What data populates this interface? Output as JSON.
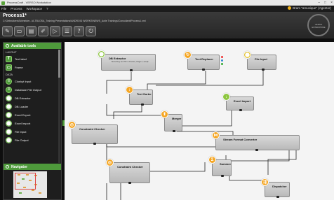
{
  "window": {
    "title": "ProcessCraft - VERSO Workstation"
  },
  "menu": {
    "items": [
      "File",
      "Process",
      "Workspace",
      "?"
    ],
    "user": "Bram \"amusique\" (Agentor)"
  },
  "header": {
    "title": "Process1*",
    "path": "C:\\Gebruikers\\Schneider...\\A-TBLOSA_Training Presentations\\ANDROID WORKS\\NEWS_Actie Trainings\\Consultant\\Process1.xml",
    "logo_text": "VERSO ENTERPRISE"
  },
  "toolbar": {
    "buttons": [
      {
        "name": "new-process-button",
        "glyph": "✎"
      },
      {
        "name": "open-button",
        "glyph": "▭"
      },
      {
        "name": "save-button",
        "glyph": "▤"
      },
      {
        "name": "edit-button",
        "glyph": "✐"
      },
      {
        "name": "run-button",
        "glyph": "▷"
      },
      {
        "name": "list-button",
        "glyph": "☰"
      },
      {
        "name": "help-button",
        "glyph": "?"
      },
      {
        "name": "plugin-button",
        "glyph": "⏻"
      }
    ]
  },
  "sidebar": {
    "title": "Available tools",
    "layout_section": "LAYOUT",
    "layout_items": [
      {
        "label": "Text label",
        "glyph": "T"
      },
      {
        "label": "Frame",
        "glyph": "▭"
      }
    ],
    "data_section": "DATA",
    "data_items": [
      {
        "label": "Clonkyt Input",
        "glyph": "≡"
      },
      {
        "label": "Database File Output",
        "glyph": "≡"
      },
      {
        "label": "DB Extractor",
        "glyph": "⬤"
      },
      {
        "label": "DB Loader",
        "glyph": "⬤"
      },
      {
        "label": "Excel Export",
        "glyph": "⬤"
      },
      {
        "label": "Excel Import",
        "glyph": "⬤"
      },
      {
        "label": "File Input",
        "glyph": "⬤"
      },
      {
        "label": "File Output",
        "glyph": "⬤"
      }
    ]
  },
  "navigator": {
    "title": "Navigator"
  },
  "nodes": {
    "db_extractor": {
      "label": "DB Extractor",
      "sub": "Bemerking van HR in dit tekst | Vragen, Leerrijk"
    },
    "text_replacer": {
      "label": "Text Replacer"
    },
    "file_input": {
      "label": "File Input"
    },
    "text_sorter": {
      "label": "Text Sorter"
    },
    "excel_import": {
      "label": "Excel Import"
    },
    "merger": {
      "label": "Merger"
    },
    "constraint_checker_1": {
      "label": "Constraint Checker"
    },
    "stream_format_converter": {
      "label": "Stream Format Converter"
    },
    "constraint_checker_2": {
      "label": "Constraint Checker"
    },
    "summer": {
      "label": "Summer"
    },
    "dispatcher": {
      "label": "Dispatcher"
    }
  },
  "colors": {
    "accent_green": "#4e9a3b",
    "badge_orange": "#f5a623",
    "badge_green": "#8dc63f",
    "canvas": "#f4f4f4"
  }
}
